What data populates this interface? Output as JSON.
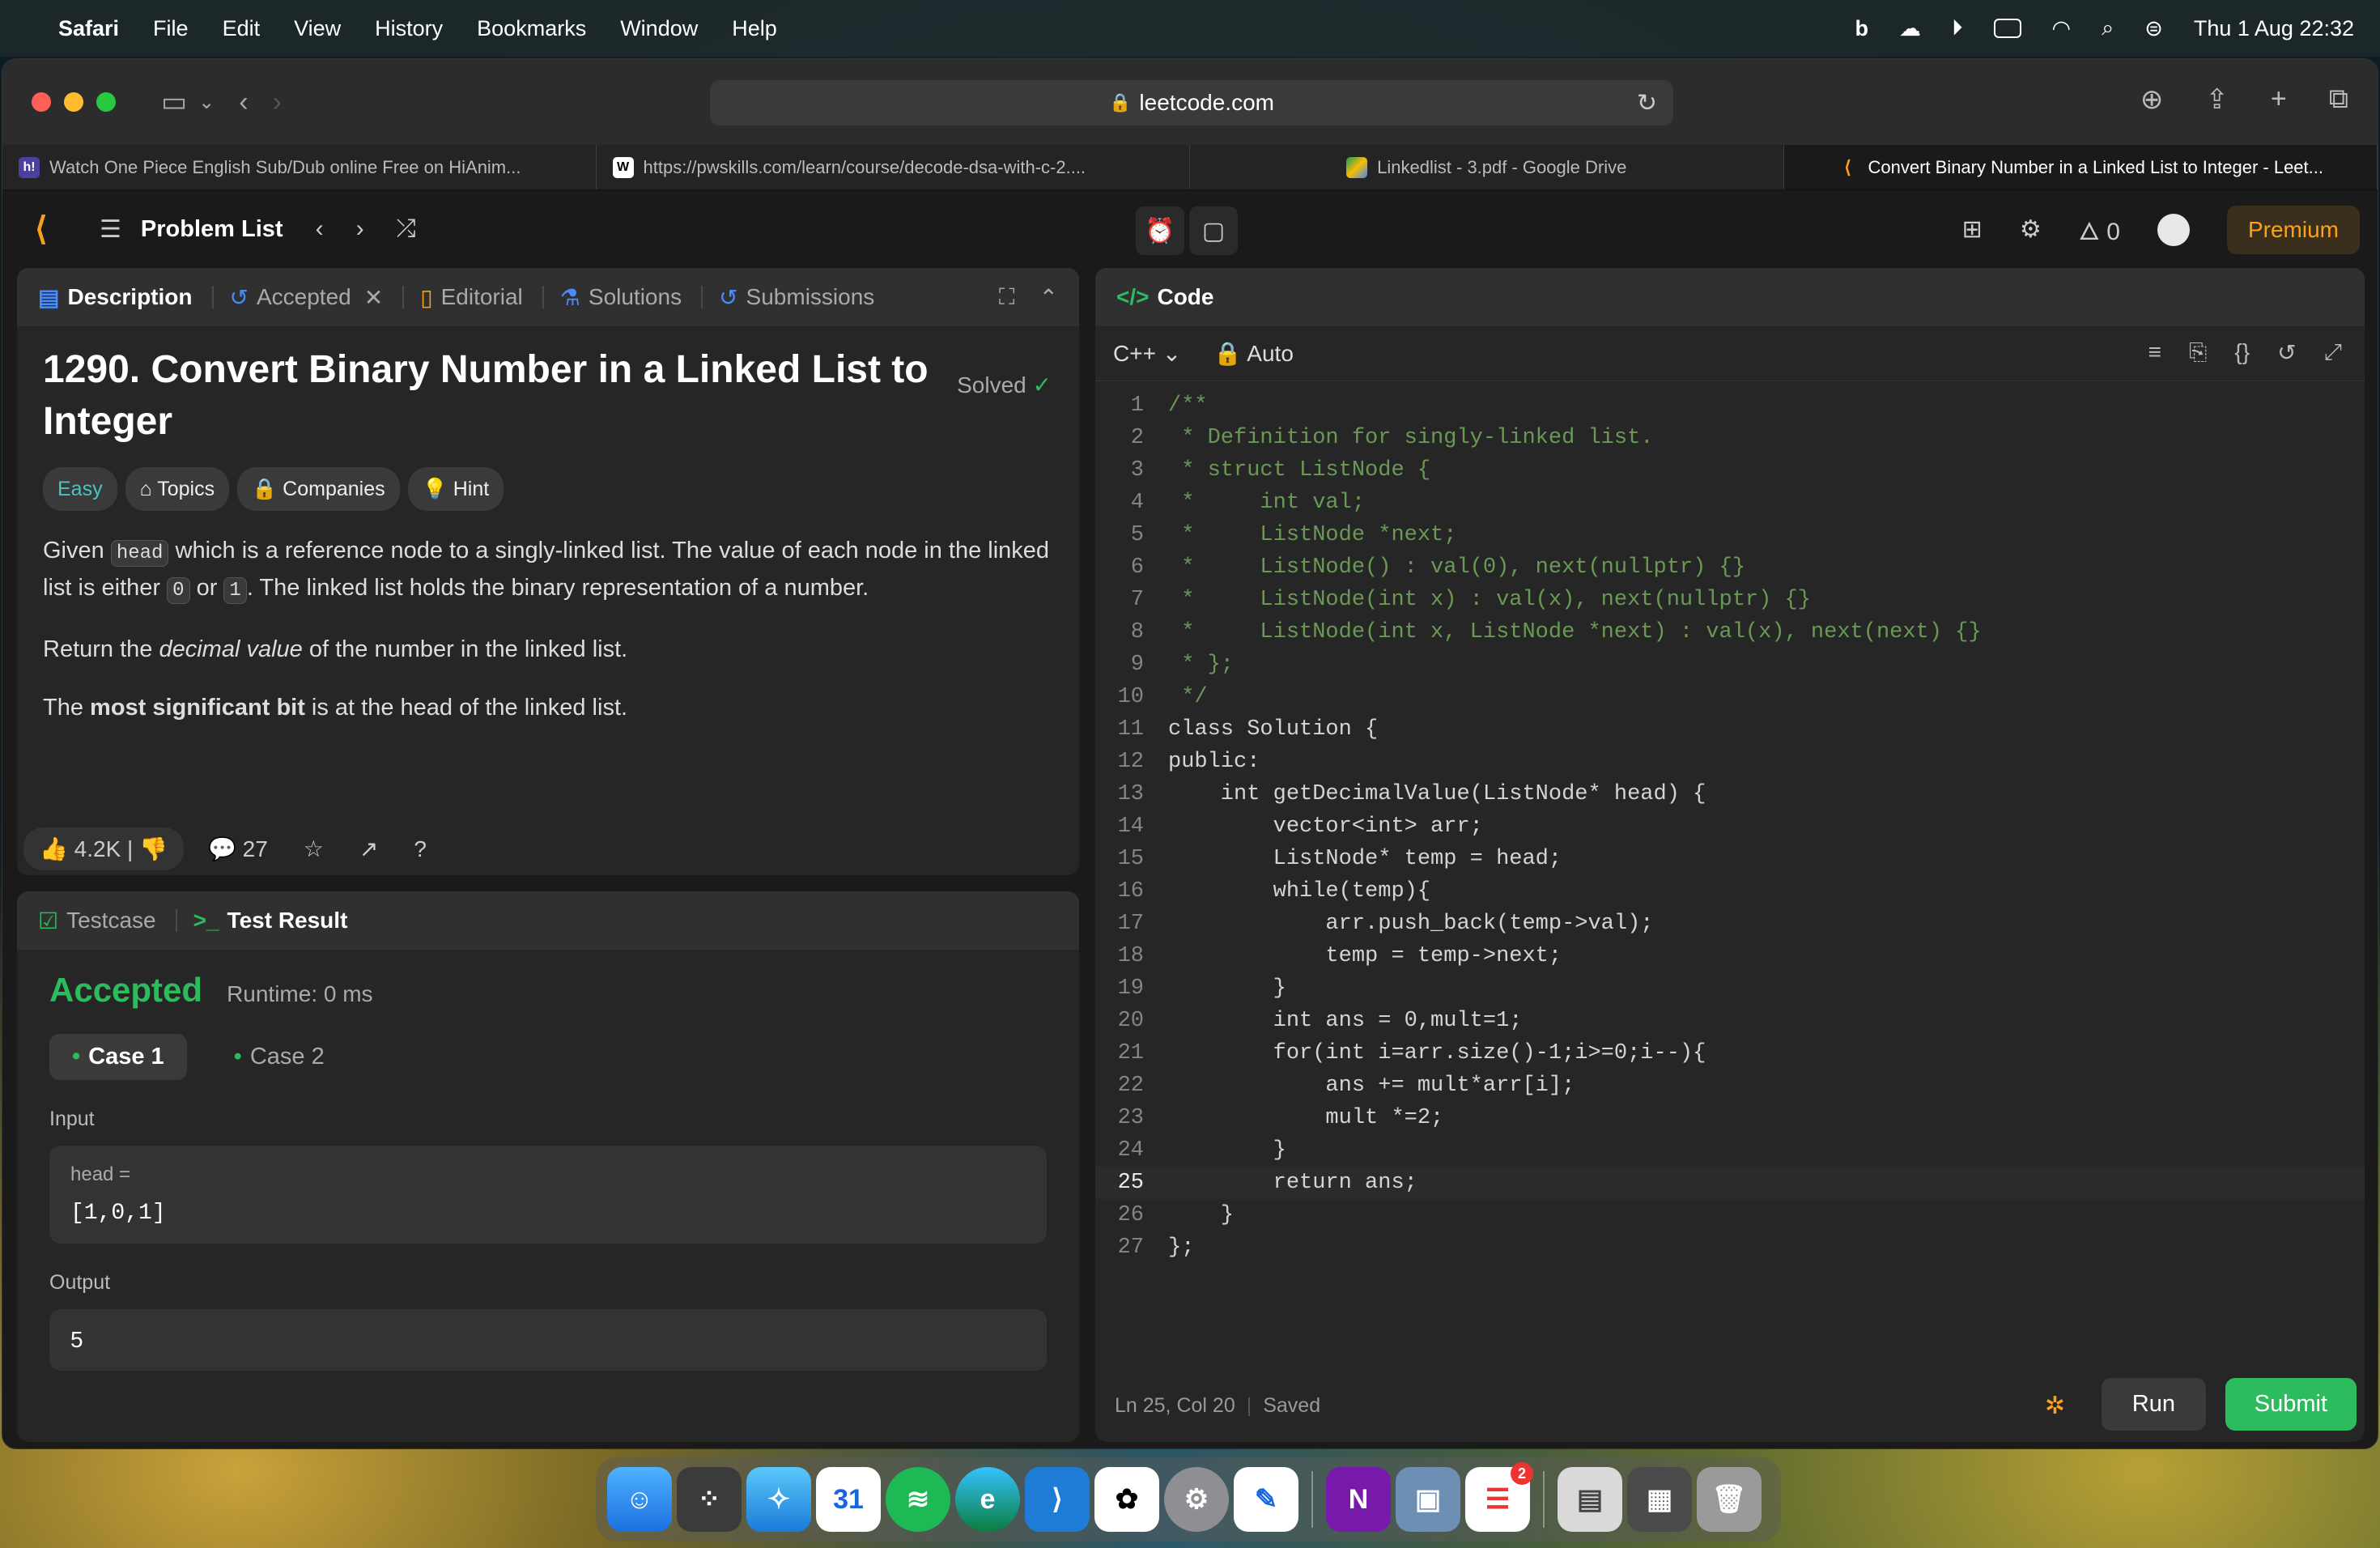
{
  "menubar": {
    "app": "Safari",
    "items": [
      "File",
      "Edit",
      "View",
      "History",
      "Bookmarks",
      "Window",
      "Help"
    ],
    "datetime": "Thu 1 Aug  22:32"
  },
  "browser": {
    "url": "leetcode.com",
    "tabs": [
      {
        "label": "Watch One Piece English Sub/Dub online Free on HiAnim...",
        "favicon_text": "h!",
        "favicon_color": "#6b5cff"
      },
      {
        "label": "https://pwskills.com/learn/course/decode-dsa-with-c-2....",
        "favicon_text": "",
        "favicon_color": "#ffffff"
      },
      {
        "label": "Linkedlist - 3.pdf - Google Drive",
        "favicon_text": "",
        "favicon_color": "#fbbc04"
      },
      {
        "label": "Convert Binary Number in a Linked List to Integer - Leet...",
        "favicon_text": "",
        "favicon_color": "#ffa116",
        "active": true
      }
    ]
  },
  "nav": {
    "problem_list": "Problem List",
    "streak": "0",
    "premium": "Premium"
  },
  "left_panel": {
    "tabs": {
      "description": "Description",
      "accepted": "Accepted",
      "editorial": "Editorial",
      "solutions": "Solutions",
      "submissions": "Submissions"
    },
    "title": "1290. Convert Binary Number in a Linked List to Integer",
    "solved": "Solved",
    "chips": {
      "difficulty": "Easy",
      "topics": "Topics",
      "companies": "Companies",
      "hint": "Hint"
    },
    "p1": {
      "a": "Given ",
      "code1": "head",
      "b": " which is a reference node to a singly-linked list. The value of each node in the linked list is either ",
      "code2": "0",
      "c": " or ",
      "code3": "1",
      "d": ". The linked list holds the binary representation of a number."
    },
    "p2": {
      "a": "Return the ",
      "em": "decimal value",
      "b": " of the number in the linked list."
    },
    "p3": {
      "a": "The ",
      "strong": "most significant bit",
      "b": " is at the head of the linked list."
    },
    "footer": {
      "likes": "4.2K",
      "comments": "27"
    }
  },
  "test_panel": {
    "testcase": "Testcase",
    "test_result": "Test Result",
    "status": "Accepted",
    "runtime": "Runtime: 0 ms",
    "case1": "Case 1",
    "case2": "Case 2",
    "input_label": "Input",
    "input_key": "head =",
    "input_value": "[1,0,1]",
    "output_label": "Output",
    "output_value": "5"
  },
  "code_panel": {
    "title": "Code",
    "language": "C++",
    "mode": "Auto",
    "status": "Ln 25, Col 20",
    "saved": "Saved",
    "run": "Run",
    "submit": "Submit",
    "current_line": 25,
    "lines": [
      "/**",
      " * Definition for singly-linked list.",
      " * struct ListNode {",
      " *     int val;",
      " *     ListNode *next;",
      " *     ListNode() : val(0), next(nullptr) {}",
      " *     ListNode(int x) : val(x), next(nullptr) {}",
      " *     ListNode(int x, ListNode *next) : val(x), next(next) {}",
      " * };",
      " */",
      "class Solution {",
      "public:",
      "    int getDecimalValue(ListNode* head) {",
      "        vector<int> arr;",
      "        ListNode* temp = head;",
      "        while(temp){",
      "            arr.push_back(temp->val);",
      "            temp = temp->next;",
      "        }",
      "        int ans = 0,mult=1;",
      "        for(int i=arr.size()-1;i>=0;i--){",
      "            ans += mult*arr[i];",
      "            mult *=2;",
      "        }",
      "        return ans;",
      "    }",
      "};"
    ]
  },
  "dock": {
    "calendar_day": "31",
    "reminders_badge": "2",
    "apps": [
      "Finder",
      "Launchpad",
      "Safari",
      "Calendar",
      "Spotify",
      "Edge",
      "VS Code",
      "ChatGPT",
      "System Settings",
      "Freeform",
      "OneNote",
      "Preview",
      "Reminders",
      "Documents",
      "Screenshots",
      "Trash"
    ]
  }
}
